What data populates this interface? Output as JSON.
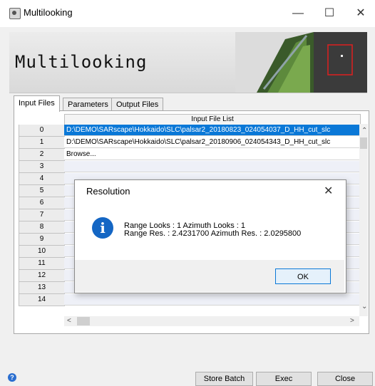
{
  "window": {
    "title": "Multilooking",
    "minimize": "—",
    "maximize": "☐",
    "close": "✕"
  },
  "banner": {
    "title": "Multilooking"
  },
  "tabs": [
    {
      "label": "Input Files"
    },
    {
      "label": "Parameters"
    },
    {
      "label": "Output Files"
    }
  ],
  "table": {
    "header": "Input File List",
    "rows": [
      {
        "num": "0",
        "value": "D:\\DEMO\\SARscape\\Hokkaido\\SLC\\palsar2_20180823_024054037_D_HH_cut_slc"
      },
      {
        "num": "1",
        "value": "D:\\DEMO\\SARscape\\Hokkaido\\SLC\\palsar2_20180906_024054343_D_HH_cut_slc"
      },
      {
        "num": "2",
        "value": "Browse..."
      },
      {
        "num": "3",
        "value": ""
      },
      {
        "num": "4",
        "value": ""
      },
      {
        "num": "5",
        "value": ""
      },
      {
        "num": "6",
        "value": ""
      },
      {
        "num": "7",
        "value": ""
      },
      {
        "num": "8",
        "value": ""
      },
      {
        "num": "9",
        "value": ""
      },
      {
        "num": "10",
        "value": ""
      },
      {
        "num": "11",
        "value": ""
      },
      {
        "num": "12",
        "value": ""
      },
      {
        "num": "13",
        "value": ""
      },
      {
        "num": "14",
        "value": ""
      }
    ]
  },
  "dialog": {
    "title": "Resolution",
    "line1": "Range Looks : 1   Azimuth Looks : 1",
    "line2": "Range Res. : 2.4231700   Azimuth Res. : 2.0295800",
    "ok": "OK",
    "close": "✕"
  },
  "buttons": {
    "store_batch": "Store Batch",
    "exec": "Exec",
    "close": "Close"
  },
  "icons": {
    "info": "info-icon",
    "help": "help-icon"
  },
  "colors": {
    "selection": "#0a78d7",
    "info": "#1466c4"
  }
}
